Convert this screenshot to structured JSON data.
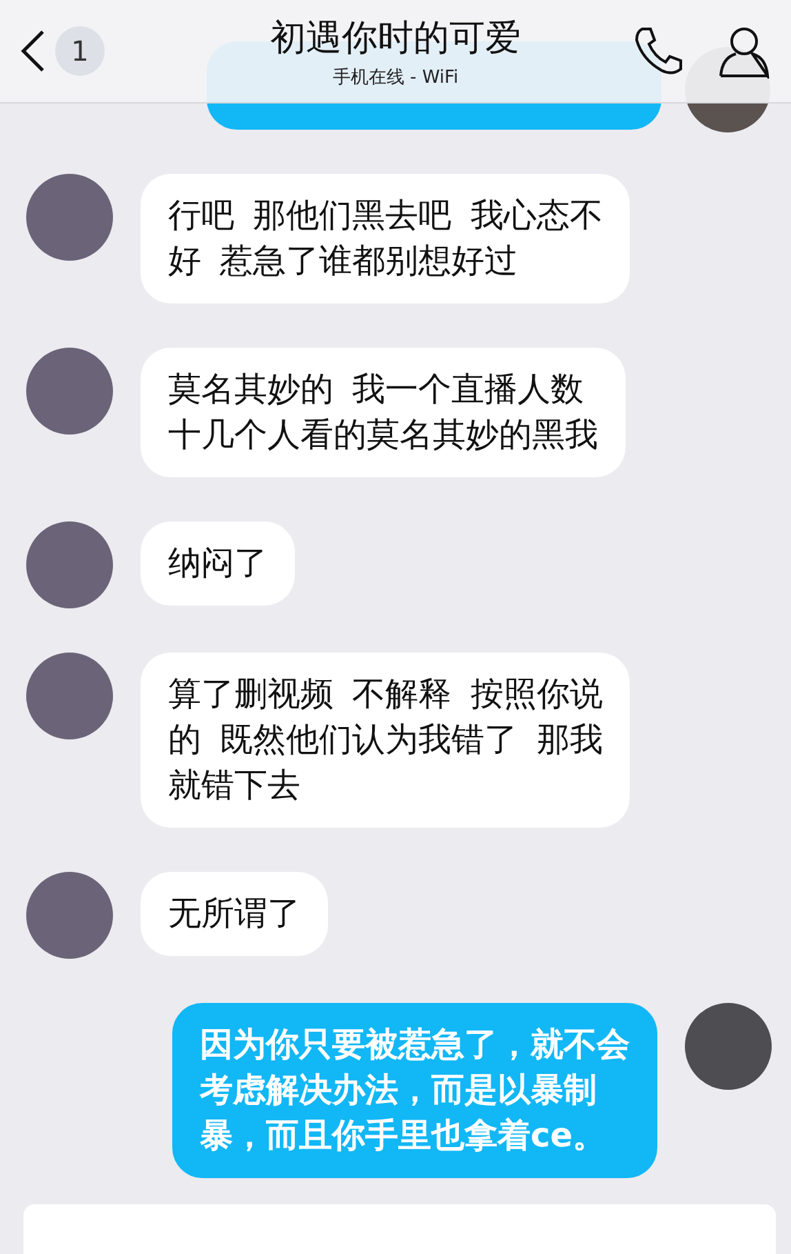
{
  "header": {
    "back_badge": "1",
    "title": "初遇你时的可爱",
    "subtitle": "手机在线 - WiFi"
  },
  "messages": [
    {
      "kind": "incoming",
      "lines": [
        "行吧 那他们黑去吧 我心态不",
        "好 惹急了谁都别想好过"
      ]
    },
    {
      "kind": "incoming",
      "lines": [
        "莫名其妙的 我一个直播人数",
        "十几个人看的莫名其妙的黑我"
      ]
    },
    {
      "kind": "incoming",
      "lines": [
        "纳闷了"
      ]
    },
    {
      "kind": "incoming",
      "lines": [
        "算了删视频 不解释 按照你说",
        "的 既然他们认为我错了 那我",
        "就错下去"
      ]
    },
    {
      "kind": "incoming",
      "lines": [
        "无所谓了"
      ]
    },
    {
      "kind": "outgoing",
      "lines": [
        "因为你只要被惹急了，就不会",
        "考虑解决办法，而是以暴制",
        "暴，而且你手里也拿着ce。"
      ]
    }
  ]
}
